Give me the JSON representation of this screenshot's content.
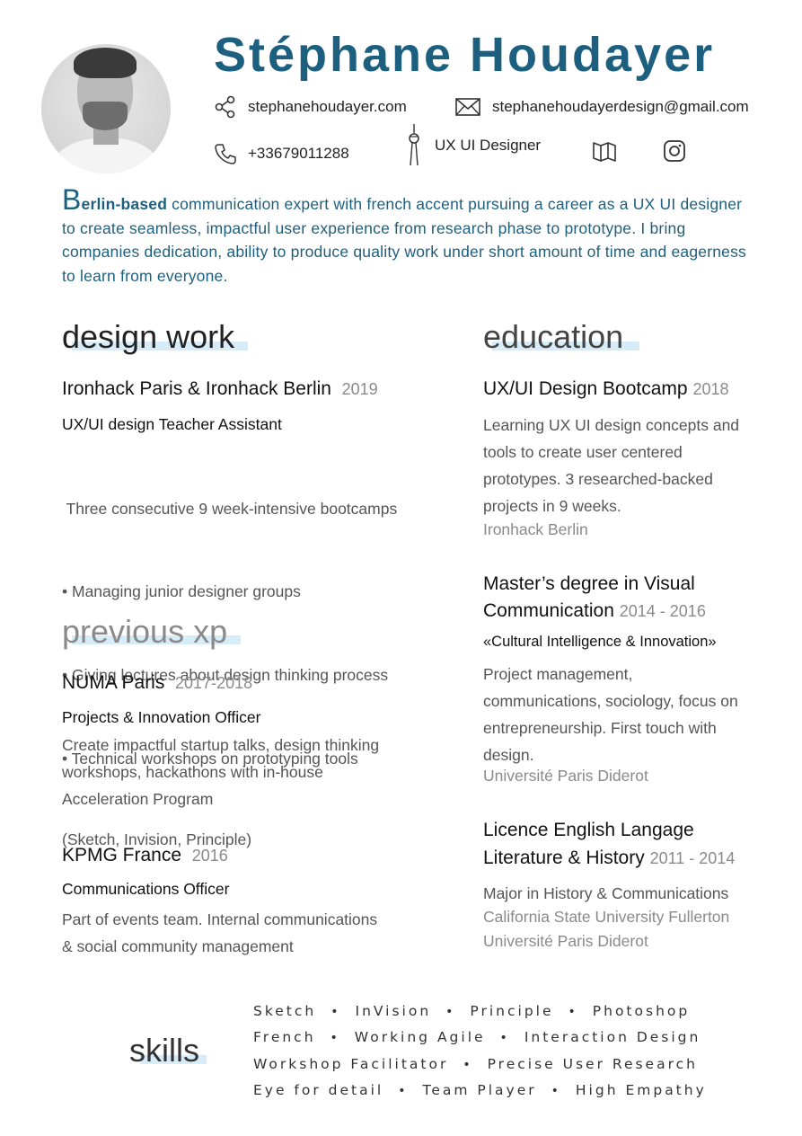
{
  "header": {
    "name": "Stéphane Houdayer",
    "website": "stephanehoudayer.com",
    "email": "stephanehoudayerdesign@gmail.com",
    "phone": "+33679011288",
    "job_title": "UX UI Designer",
    "icons": [
      "share-icon",
      "mail-icon",
      "phone-icon",
      "tower-icon",
      "behance-book-icon",
      "instagram-icon"
    ]
  },
  "intro": {
    "first_letter": "B",
    "bold_rest": "erlin-based",
    "text": " communication expert with french accent pursuing a career as a UX UI designer to create seamless, impactful user experience from research phase to prototype. I bring companies dedication, ability to produce quality work under short amount of time and eagerness to learn from everyone."
  },
  "design_work": {
    "title": "design work",
    "items": [
      {
        "company": "Ironhack Paris & Ironhack Berlin",
        "year": "2019",
        "role": "UX/UI design Teacher Assistant",
        "lines": [
          " Three consecutive 9 week-intensive bootcamps",
          "• Managing junior designer groups",
          "• Giving lectures about design thinking process",
          "• Technical workshops on prototyping tools",
          "(Sketch, Invision, Principle)"
        ]
      }
    ]
  },
  "previous_xp": {
    "title": "previous xp",
    "items": [
      {
        "company": "NUMA Paris",
        "year": "2017-2018",
        "role": "Projects & Innovation Officer",
        "lines": [
          "Create impactful startup talks, design thinking",
          "workshops, hackathons with in-house",
          "Acceleration Program"
        ]
      },
      {
        "company": "KPMG France",
        "year": "2016",
        "role": "Communications Officer",
        "lines": [
          "Part of events team. Internal communications",
          "& social community management"
        ]
      }
    ]
  },
  "education": {
    "title": "education",
    "items": [
      {
        "title_lines": [
          "UX/UI Design Bootcamp"
        ],
        "year": "2018",
        "lines": [
          "Learning UX UI design concepts and",
          "tools to create user centered",
          "prototypes. 3 researched-backed",
          "projects in 9 weeks."
        ],
        "schools": [
          "Ironhack Berlin"
        ]
      },
      {
        "title_lines": [
          "Master’s degree in Visual",
          "Communication"
        ],
        "year": "2014 - 2016",
        "subtitle": "«Cultural Intelligence & Innovation»",
        "lines": [
          "Project management,",
          "communications, sociology, focus on",
          "entrepreneurship. First touch with",
          "design."
        ],
        "schools": [
          "Université Paris Diderot"
        ]
      },
      {
        "title_lines": [
          "Licence English Langage",
          "Literature & History"
        ],
        "year": "2011 - 2014",
        "lines": [
          "Major in History & Communications"
        ],
        "schools": [
          "California State University Fullerton",
          "Université Paris Diderot"
        ]
      }
    ]
  },
  "skills": {
    "title": "skills",
    "rows": [
      [
        "Sketch",
        "InVision",
        "Principle",
        "Photoshop"
      ],
      [
        "French",
        "Working Agile",
        "Interaction Design"
      ],
      [
        "Workshop Facilitator",
        "Precise User Research"
      ],
      [
        "Eye for detail",
        "Team Player",
        "High Empathy"
      ]
    ]
  },
  "colors": {
    "accent": "#1d5f7e",
    "highlight": "#d6ecf8",
    "muted": "#8a8a8a"
  }
}
